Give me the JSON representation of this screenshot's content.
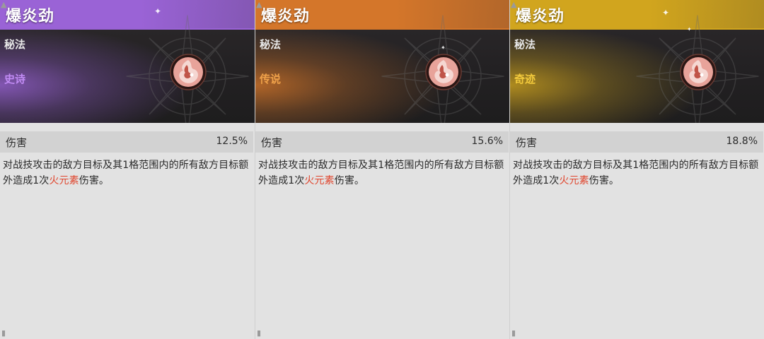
{
  "cards": [
    {
      "title": "爆炎劲",
      "category": "秘法",
      "rarity": "史诗",
      "rarity_color": "#c28cf5",
      "theme_color": "#9a63d6",
      "stat_label": "伤害",
      "stat_value": "12.5%",
      "desc_before": "对战技攻击的敌方目标及其1格范围内的所有敌方目标额外造成1次",
      "desc_highlight": "火元素",
      "desc_after": "伤害。",
      "icon": "fire-element-orb-icon"
    },
    {
      "title": "爆炎劲",
      "category": "秘法",
      "rarity": "传说",
      "rarity_color": "#f0a24a",
      "theme_color": "#d4762a",
      "stat_label": "伤害",
      "stat_value": "15.6%",
      "desc_before": "对战技攻击的敌方目标及其1格范围内的所有敌方目标额外造成1次",
      "desc_highlight": "火元素",
      "desc_after": "伤害。",
      "icon": "fire-element-orb-icon"
    },
    {
      "title": "爆炎劲",
      "category": "秘法",
      "rarity": "奇迹",
      "rarity_color": "#f2c93c",
      "theme_color": "#d1a51e",
      "stat_label": "伤害",
      "stat_value": "18.8%",
      "desc_before": "对战技攻击的敌方目标及其1格范围内的所有敌方目标额外造成1次",
      "desc_highlight": "火元素",
      "desc_after": "伤害。",
      "icon": "fire-element-orb-icon"
    }
  ],
  "highlight_color": "#e0462e"
}
